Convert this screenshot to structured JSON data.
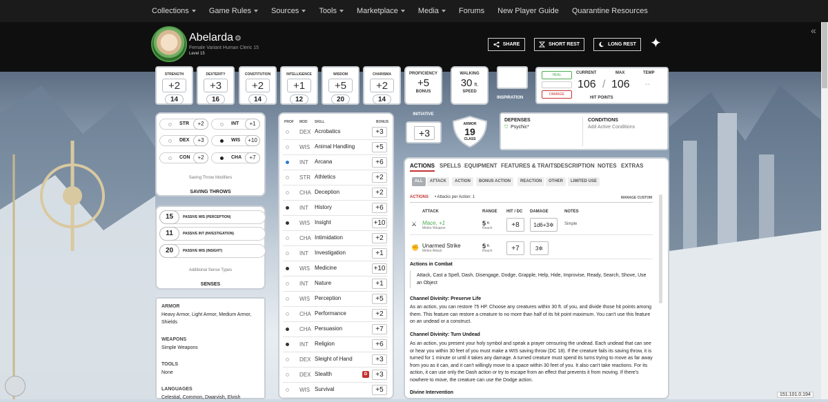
{
  "nav": [
    "Collections",
    "Game Rules",
    "Sources",
    "Tools",
    "Marketplace",
    "Media",
    "Forums",
    "New Player Guide",
    "Quarantine Resources"
  ],
  "nav_has_caret": [
    true,
    true,
    true,
    true,
    true,
    true,
    false,
    false,
    false
  ],
  "character": {
    "name": "Abelarda",
    "info": "Female  Variant Human  Cleric 15",
    "level": "Level 15"
  },
  "header_buttons": {
    "share": "SHARE",
    "short_rest": "SHORT REST",
    "long_rest": "LONG REST"
  },
  "abilities": [
    {
      "label": "STRENGTH",
      "mod": "+2",
      "score": "14"
    },
    {
      "label": "DEXTERITY",
      "mod": "+3",
      "score": "16"
    },
    {
      "label": "CONSTITUTION",
      "mod": "+2",
      "score": "14"
    },
    {
      "label": "INTELLIGENCE",
      "mod": "+1",
      "score": "12"
    },
    {
      "label": "WISDOM",
      "mod": "+5",
      "score": "20"
    },
    {
      "label": "CHARISMA",
      "mod": "+2",
      "score": "14"
    }
  ],
  "proficiency": {
    "top": "PROFICIENCY",
    "value": "+5",
    "bottom": "BONUS"
  },
  "walking": {
    "top": "WALKING",
    "value": "30",
    "unit": "ft.",
    "bottom": "SPEED"
  },
  "inspiration": {
    "label": "INSPIRATION"
  },
  "hp": {
    "heal": "HEAL",
    "damage": "DAMAGE",
    "current_label": "CURRENT",
    "max_label": "MAX",
    "temp_label": "TEMP",
    "current": "106",
    "slash": "/",
    "max": "106",
    "temp": "--",
    "title": "HIT POINTS"
  },
  "saving_throws": {
    "items": [
      {
        "label": "STR",
        "value": "+2",
        "prof": false
      },
      {
        "label": "INT",
        "value": "+1",
        "prof": false
      },
      {
        "label": "DEX",
        "value": "+3",
        "prof": false
      },
      {
        "label": "WIS",
        "value": "+10",
        "prof": true
      },
      {
        "label": "CON",
        "value": "+2",
        "prof": false
      },
      {
        "label": "CHA",
        "value": "+7",
        "prof": true
      }
    ],
    "modifiers": "Saving Throw Modifiers",
    "title": "SAVING THROWS"
  },
  "senses": {
    "items": [
      {
        "value": "15",
        "label": "PASSIVE WIS (PERCEPTION)"
      },
      {
        "value": "11",
        "label": "PASSIVE INT (INVESTIGATION)"
      },
      {
        "value": "20",
        "label": "PASSIVE WIS (INSIGHT)"
      }
    ],
    "additional": "Additional Sense Types",
    "title": "SENSES"
  },
  "proficiencies": {
    "armor_h": "ARMOR",
    "armor": "Heavy Armor, Light Armor, Medium Armor, Shields",
    "weapons_h": "WEAPONS",
    "weapons": "Simple Weapons",
    "tools_h": "TOOLS",
    "tools": "None",
    "languages_h": "LANGUAGES",
    "languages": "Celestial, Common, Dwarvish, Elvish"
  },
  "skills_header": {
    "prof": "PROF",
    "mod": "MOD",
    "skill": "SKILL",
    "bonus": "BONUS"
  },
  "skills": [
    {
      "mod": "DEX",
      "name": "Acrobatics",
      "bonus": "+3",
      "p": "none"
    },
    {
      "mod": "WIS",
      "name": "Animal Handling",
      "bonus": "+5",
      "p": "none"
    },
    {
      "mod": "INT",
      "name": "Arcana",
      "bonus": "+6",
      "p": "half"
    },
    {
      "mod": "STR",
      "name": "Athletics",
      "bonus": "+2",
      "p": "none"
    },
    {
      "mod": "CHA",
      "name": "Deception",
      "bonus": "+2",
      "p": "none"
    },
    {
      "mod": "INT",
      "name": "History",
      "bonus": "+6",
      "p": "full"
    },
    {
      "mod": "WIS",
      "name": "Insight",
      "bonus": "+10",
      "p": "full"
    },
    {
      "mod": "CHA",
      "name": "Intimidation",
      "bonus": "+2",
      "p": "none"
    },
    {
      "mod": "INT",
      "name": "Investigation",
      "bonus": "+1",
      "p": "none"
    },
    {
      "mod": "WIS",
      "name": "Medicine",
      "bonus": "+10",
      "p": "full"
    },
    {
      "mod": "INT",
      "name": "Nature",
      "bonus": "+1",
      "p": "none"
    },
    {
      "mod": "WIS",
      "name": "Perception",
      "bonus": "+5",
      "p": "none"
    },
    {
      "mod": "CHA",
      "name": "Performance",
      "bonus": "+2",
      "p": "none"
    },
    {
      "mod": "CHA",
      "name": "Persuasion",
      "bonus": "+7",
      "p": "full"
    },
    {
      "mod": "INT",
      "name": "Religion",
      "bonus": "+6",
      "p": "full"
    },
    {
      "mod": "DEX",
      "name": "Sleight of Hand",
      "bonus": "+3",
      "p": "none"
    },
    {
      "mod": "DEX",
      "name": "Stealth",
      "bonus": "+3",
      "p": "none",
      "disadvantage": "D"
    },
    {
      "mod": "WIS",
      "name": "Survival",
      "bonus": "+5",
      "p": "none"
    }
  ],
  "initiative": {
    "label": "INITIATIVE",
    "value": "+3"
  },
  "armor_class": {
    "top": "ARMOR",
    "value": "19",
    "bottom": "CLASS"
  },
  "defenses": {
    "title": "DEFENSES",
    "value": "Psychic*"
  },
  "conditions": {
    "title": "CONDITIONS",
    "add": "Add Active Conditions"
  },
  "tabs": [
    "ACTIONS",
    "SPELLS",
    "EQUIPMENT",
    "FEATURES & TRAITS",
    "DESCRIPTION",
    "NOTES",
    "EXTRAS"
  ],
  "subtabs": [
    "ALL",
    "ATTACK",
    "ACTION",
    "BONUS ACTION",
    "REACTION",
    "OTHER",
    "LIMITED USE"
  ],
  "actions": {
    "header": "ACTIONS",
    "attacks_per": "• Attacks per Action: 1",
    "manage": "MANAGE CUSTOM",
    "cols": {
      "attack": "ATTACK",
      "range": "RANGE",
      "hit": "HIT / DC",
      "damage": "DAMAGE",
      "notes": "NOTES"
    },
    "rows": [
      {
        "name": "Mace, +1",
        "sub": "Melee Weapon",
        "range": "5",
        "range_unit": "ft.",
        "reach": "Reach",
        "hit": "+8",
        "damage": "1d6+3",
        "notes": "Simple"
      },
      {
        "name": "Unarmed Strike",
        "sub": "Melee Attack",
        "range": "5",
        "range_unit": "ft.",
        "reach": "Reach",
        "hit": "+7",
        "damage": "3",
        "notes": ""
      }
    ],
    "combat_h": "Actions in Combat",
    "combat": "Attack, Cast a Spell, Dash, Disengage, Dodge, Grapple, Help, Hide, Improvise, Ready, Search, Shove, Use an Object",
    "cd1_h": "Channel Divinity: Preserve Life",
    "cd1": "As an action, you can restore 75 HP. Choose any creatures within 30 ft. of you, and divide those hit points among them. This feature can restore a creature to no more than half of its hit point maximum. You can't use this feature on an undead or a construct.",
    "cd2_h": "Channel Divinity: Turn Undead",
    "cd2": "As an action, you present your holy symbol and speak a prayer censuring the undead. Each undead that can see or hear you within 30 feet of you must make a WIS saving throw (DC 18). If the creature fails its saving throw, it is turned for 1 minute or until it takes any damage. A turned creature must spend its turns trying to move as far away from you as it can, and it can't willingly move to a space within 30 feet of you. It also can't take reactions. For its action, it can use only the Dash action or try to escape from an effect that prevents it from moving. If there's nowhere to move, the creature can use the Dodge action.",
    "di_h": "Divine Intervention"
  },
  "ip": "151.101.0.194",
  "colors": {
    "accent": "#c53131",
    "prof_half": "#2b7bd6",
    "defense": "#4caf50",
    "nav_bg": "#1b1b1b",
    "header_bg": "#0f0f10"
  }
}
